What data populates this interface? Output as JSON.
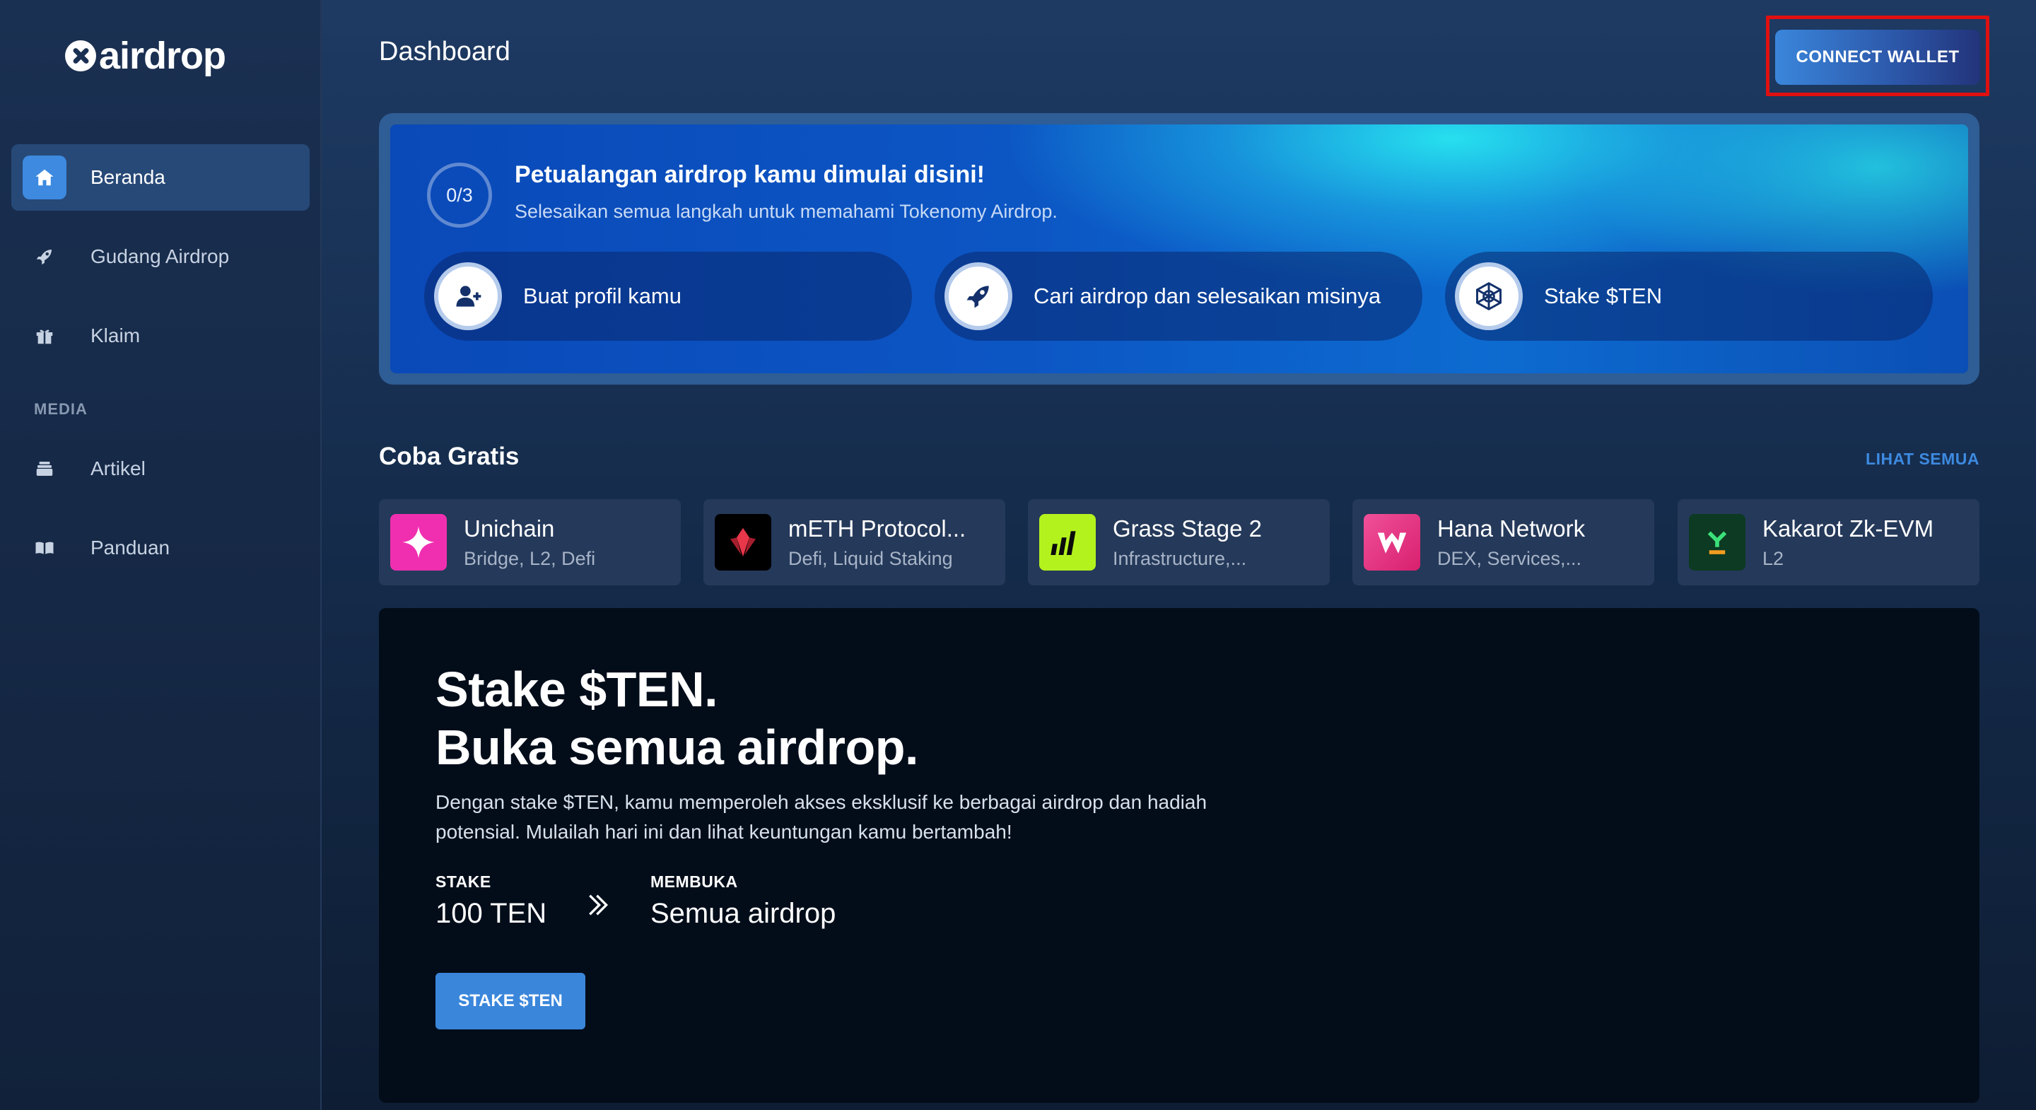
{
  "brand": {
    "name": "airdrop"
  },
  "sidebar": {
    "items": [
      {
        "label": "Beranda",
        "icon": "home-icon",
        "active": true
      },
      {
        "label": "Gudang Airdrop",
        "icon": "rocket-icon",
        "active": false
      },
      {
        "label": "Klaim",
        "icon": "gift-icon",
        "active": false
      }
    ],
    "media_label": "MEDIA",
    "media_items": [
      {
        "label": "Artikel",
        "icon": "archive-icon"
      },
      {
        "label": "Panduan",
        "icon": "book-icon"
      }
    ]
  },
  "header": {
    "title": "Dashboard",
    "connect_label": "CONNECT WALLET"
  },
  "journey": {
    "progress": "0/3",
    "title": "Petualangan airdrop kamu dimulai disini!",
    "subtitle": "Selesaikan semua langkah untuk memahami Tokenomy Airdrop.",
    "steps": [
      {
        "label": "Buat profil kamu",
        "icon": "add-user-icon"
      },
      {
        "label": "Cari airdrop dan selesaikan misinya",
        "icon": "rocket-icon"
      },
      {
        "label": "Stake $TEN",
        "icon": "network-icon"
      }
    ]
  },
  "free": {
    "title": "Coba Gratis",
    "see_all": "LIHAT SEMUA",
    "cards": [
      {
        "name": "Unichain",
        "tags": "Bridge, L2, Defi",
        "color": "#f02fb0"
      },
      {
        "name": "mETH Protocol...",
        "tags": "Defi, Liquid Staking",
        "color": "#000000"
      },
      {
        "name": "Grass Stage 2",
        "tags": "Infrastructure,...",
        "color": "#b4f21e"
      },
      {
        "name": "Hana Network",
        "tags": "DEX, Services,...",
        "color": "#e0338a"
      },
      {
        "name": "Kakarot Zk-EVM",
        "tags": "L2",
        "color": "#0c3a22"
      }
    ]
  },
  "stake": {
    "headline_1": "Stake $TEN.",
    "headline_2": "Buka semua airdrop.",
    "description": "Dengan stake $TEN, kamu memperoleh akses eksklusif ke berbagai airdrop dan hadiah potensial. Mulailah hari ini dan lihat keuntungan kamu bertambah!",
    "stake_label": "STAKE",
    "stake_value": "100 TEN",
    "unlock_label": "MEMBUKA",
    "unlock_value": "Semua airdrop",
    "button": "STAKE $TEN"
  },
  "colors": {
    "accent": "#3d8ae0",
    "highlight_border": "#e01010"
  }
}
